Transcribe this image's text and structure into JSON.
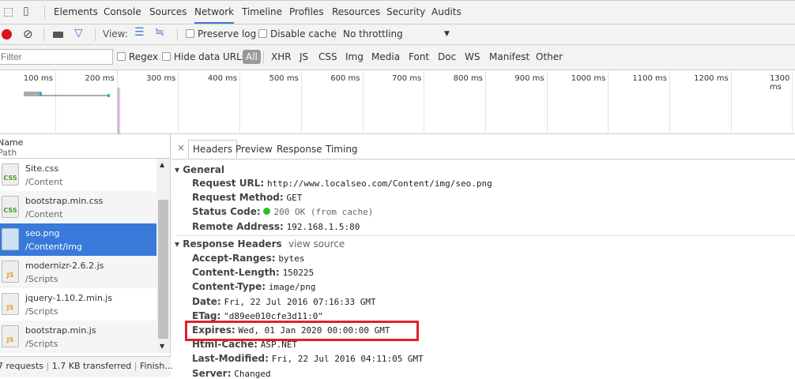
{
  "tabs": [
    "Elements",
    "Console",
    "Sources",
    "Network",
    "Timeline",
    "Profiles",
    "Resources",
    "Security",
    "Audits"
  ],
  "active_tab": "Network",
  "toolbar": {
    "view_label": "View:",
    "preserve_log": "Preserve log",
    "disable_cache": "Disable cache",
    "throttling": "No throttling"
  },
  "filter": {
    "placeholder": "Filter",
    "regex": "Regex",
    "hide_data_urls": "Hide data URLs",
    "types": [
      "All",
      "XHR",
      "JS",
      "CSS",
      "Img",
      "Media",
      "Font",
      "Doc",
      "WS",
      "Manifest",
      "Other"
    ]
  },
  "timeline_ticks": [
    "100 ms",
    "200 ms",
    "300 ms",
    "400 ms",
    "500 ms",
    "600 ms",
    "700 ms",
    "800 ms",
    "900 ms",
    "1000 ms",
    "1100 ms",
    "1200 ms",
    "1300 ms"
  ],
  "list": {
    "col_name": "Name",
    "col_path": "Path",
    "rows": [
      {
        "name": "Site.css",
        "path": "/Content",
        "type": "CSS"
      },
      {
        "name": "bootstrap.min.css",
        "path": "/Content",
        "type": "CSS"
      },
      {
        "name": "seo.png",
        "path": "/Content/img",
        "type": "IMG",
        "selected": true
      },
      {
        "name": "modernizr-2.6.2.js",
        "path": "/Scripts",
        "type": "JS"
      },
      {
        "name": "jquery-1.10.2.min.js",
        "path": "/Scripts",
        "type": "JS"
      },
      {
        "name": "bootstrap.min.js",
        "path": "/Scripts",
        "type": "JS"
      }
    ]
  },
  "status_bar": {
    "requests": "7 requests",
    "transferred": "1.7 KB transferred",
    "finish": "Finish..."
  },
  "detail": {
    "tabs": [
      "Headers",
      "Preview",
      "Response",
      "Timing"
    ],
    "close": "×",
    "general_title": "General",
    "general": [
      {
        "k": "Request URL:",
        "v": "http://www.localseo.com/Content/img/seo.png"
      },
      {
        "k": "Request Method:",
        "v": "GET"
      },
      {
        "k": "Status Code:",
        "v": "200 OK (from cache)"
      },
      {
        "k": "Remote Address:",
        "v": "192.168.1.5:80"
      }
    ],
    "response_title": "Response Headers",
    "view_source": "view source",
    "response": [
      {
        "k": "Accept-Ranges:",
        "v": "bytes"
      },
      {
        "k": "Content-Length:",
        "v": "150225"
      },
      {
        "k": "Content-Type:",
        "v": "image/png"
      },
      {
        "k": "Date:",
        "v": "Fri, 22 Jul 2016 07:16:33 GMT"
      },
      {
        "k": "ETag:",
        "v": "\"d89ee010cfe3d11:0\""
      },
      {
        "k": "Expires:",
        "v": "Wed, 01 Jan 2020 00:00:00 GMT"
      },
      {
        "k": "Html-Cache:",
        "v": "ASP.NET"
      },
      {
        "k": "Last-Modified:",
        "v": "Fri, 22 Jul 2016 04:11:05 GMT"
      },
      {
        "k": "Server:",
        "v": "Changed"
      }
    ]
  },
  "colors": {
    "accent": "#3879d9",
    "highlight": "#e0202a",
    "status_ok": "#2fbf2f"
  }
}
